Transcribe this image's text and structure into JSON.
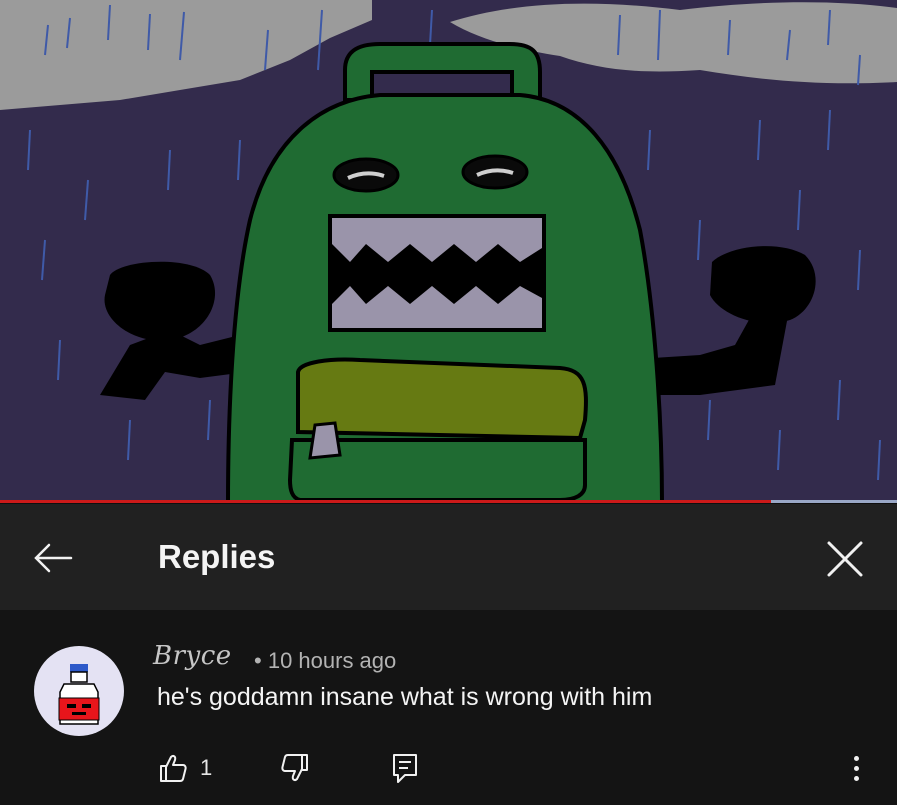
{
  "video": {
    "playback_progress": 0.86,
    "colors": {
      "sky": "#332b4c",
      "cloud": "#9b9b9b",
      "body": "#1f6b32",
      "pocket": "#667a12",
      "teeth": "#9a94aa"
    }
  },
  "header": {
    "back_icon": "arrow-left-icon",
    "title": "Replies",
    "close_icon": "close-icon"
  },
  "comment": {
    "author": "Bryce",
    "separator": "•",
    "timestamp": "10 hours ago",
    "text": "he's goddamn insane what is wrong with him",
    "like_count": "1",
    "icons": {
      "like": "thumbs-up-icon",
      "dislike": "thumbs-down-icon",
      "reply": "reply-icon",
      "more": "more-vert-icon"
    }
  }
}
